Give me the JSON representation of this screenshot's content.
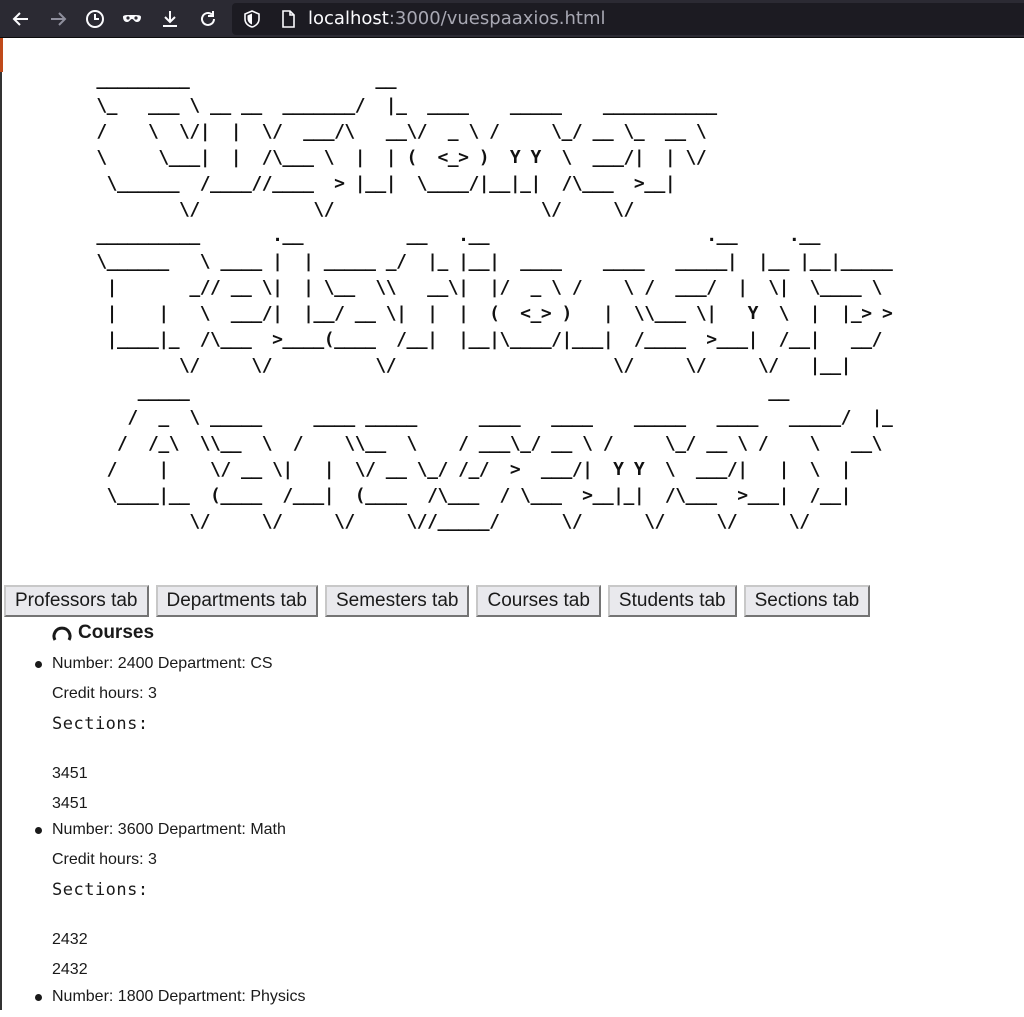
{
  "browser": {
    "url_host": "localhost",
    "url_rest": ":3000/vuespaaxios.html"
  },
  "banner": {
    "ascii_art": " _________                  __                                                \n \\_   ___ \\ __ __  _______/  |_  ____    _____    ___________               \n /    \\  \\/|  |  \\/  ___/\\   __\\/  _ \\ /     \\_/ __ \\_  __ \\              \n \\     \\___|  |  /\\___ \\  |  | (  <_> )  Y Y  \\  ___/|  | \\/              \n  \\______  /____//____  > |__|  \\____/|__|_|  /\\___  >__|                  \n         \\/           \\/                    \\/     \\/                      \n __________       .__          __   .__                     .__     .__       \n \\______   \\ ____ |  | _____ _/  |_ |__|  ____    ____   _____|  |__ |__|_____  \n  |       _// __ \\|  | \\__  \\\\   __\\|  |/  _ \\ /    \\ /  ___/  |  \\|  \\____ \\ \n  |    |   \\  ___/|  |__/ __ \\|  |  |  (  <_> )   |  \\\\___ \\|   Y  \\  |  |_> >\n  |____|_  /\\___  >____(____  /__|  |__|\\____/|___|  /____  >___|  /__|   __/ \n         \\/     \\/          \\/                     \\/     \\/     \\/   |__|    \n     _____                                                        __          \n    /  _  \\ _____     ____ _____      ____   ____    _____   ____   _____/  |_   \n   /  /_\\  \\\\__  \\  /    \\\\__  \\    / ___\\_/ __ \\ /     \\_/ __ \\ /    \\   __\\  \n  /    |    \\/ __ \\|   |  \\/ __ \\_/ /_/  >  ___/|  Y Y  \\  ___/|   |  \\  |    \n  \\____|__  (____  /___|  (____  /\\___  / \\___  >__|_|  /\\___  >___|  /__|    \n          \\/     \\/     \\/     \\//_____/      \\/      \\/     \\/     \\/        "
  },
  "tabs": [
    {
      "label": "Professors tab"
    },
    {
      "label": "Departments tab"
    },
    {
      "label": "Semesters tab"
    },
    {
      "label": "Courses tab"
    },
    {
      "label": "Students tab"
    },
    {
      "label": "Sections tab"
    }
  ],
  "courses_section": {
    "title": "Courses",
    "icon": "spinner-icon",
    "sections_label": "Sections:",
    "courses": [
      {
        "number_line": "Number: 2400 Department: CS",
        "credit_line": "Credit hours: 3",
        "sections": [
          "3451",
          "3451"
        ]
      },
      {
        "number_line": "Number: 3600 Department: Math",
        "credit_line": "Credit hours: 3",
        "sections": [
          "2432",
          "2432"
        ]
      },
      {
        "number_line": "Number: 1800 Department: Physics"
      }
    ]
  },
  "colors": {
    "chrome_bg": "#2b2a33",
    "urlbar_bg": "#1c1b22",
    "tab_bg": "#e9e9ed"
  }
}
